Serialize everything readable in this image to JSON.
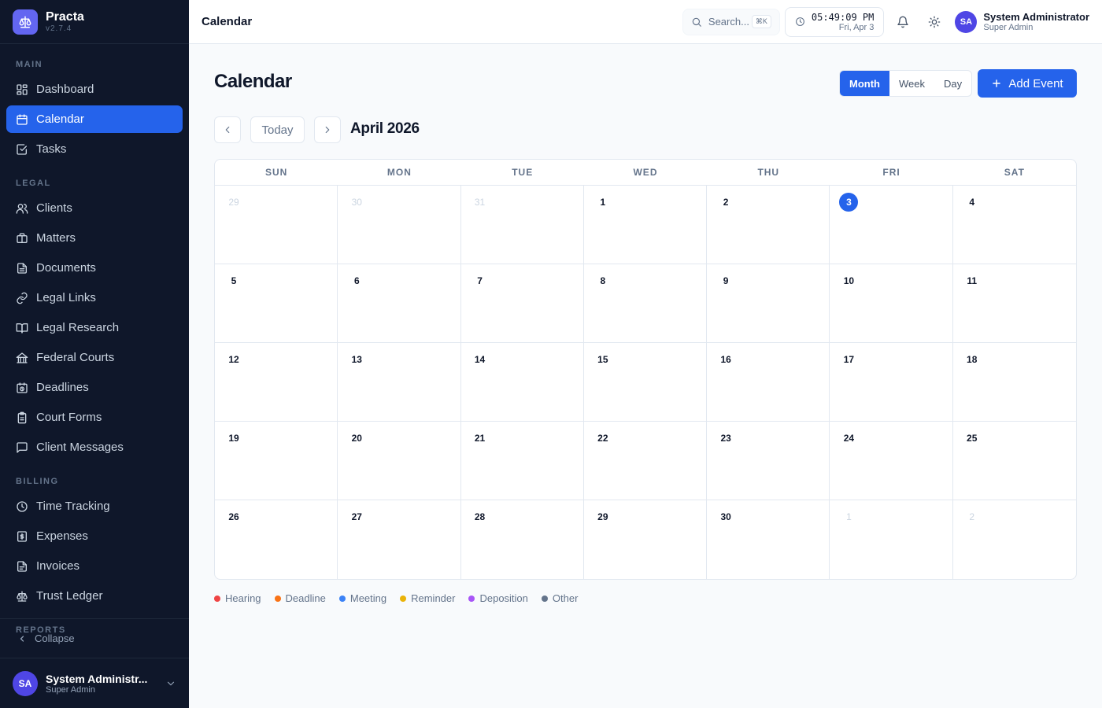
{
  "brand": {
    "name": "Practa",
    "version": "v2.7.4"
  },
  "sidebar": {
    "sections": [
      {
        "title": "MAIN",
        "items": [
          {
            "label": "Dashboard",
            "icon": "dashboard-icon"
          },
          {
            "label": "Calendar",
            "icon": "calendar-icon",
            "active": true
          },
          {
            "label": "Tasks",
            "icon": "tasks-icon"
          }
        ]
      },
      {
        "title": "LEGAL",
        "items": [
          {
            "label": "Clients",
            "icon": "users-icon"
          },
          {
            "label": "Matters",
            "icon": "briefcase-icon"
          },
          {
            "label": "Documents",
            "icon": "document-icon"
          },
          {
            "label": "Legal Links",
            "icon": "link-icon"
          },
          {
            "label": "Legal Research",
            "icon": "book-icon"
          },
          {
            "label": "Federal Courts",
            "icon": "courthouse-icon"
          },
          {
            "label": "Deadlines",
            "icon": "calendar-clock-icon"
          },
          {
            "label": "Court Forms",
            "icon": "clipboard-icon"
          },
          {
            "label": "Client Messages",
            "icon": "message-icon"
          }
        ]
      },
      {
        "title": "BILLING",
        "items": [
          {
            "label": "Time Tracking",
            "icon": "clock-icon"
          },
          {
            "label": "Expenses",
            "icon": "receipt-icon"
          },
          {
            "label": "Invoices",
            "icon": "invoice-icon"
          },
          {
            "label": "Trust Ledger",
            "icon": "scale-icon"
          }
        ]
      },
      {
        "title": "REPORTS",
        "items": []
      }
    ],
    "collapse_label": "Collapse",
    "user": {
      "initials": "SA",
      "name": "System Administr...",
      "role": "Super Admin"
    }
  },
  "header": {
    "title": "Calendar",
    "search_placeholder": "Search...",
    "search_shortcut": "⌘K",
    "clock_time": "05:49:09 PM",
    "clock_date": "Fri, Apr 3",
    "user": {
      "initials": "SA",
      "name": "System Administrator",
      "role": "Super Admin"
    }
  },
  "main": {
    "page_title": "Calendar",
    "views": [
      {
        "label": "Month",
        "active": true
      },
      {
        "label": "Week",
        "active": false
      },
      {
        "label": "Day",
        "active": false
      }
    ],
    "add_event_label": "Add Event",
    "today_label": "Today",
    "month_title": "April 2026",
    "weekdays": [
      "SUN",
      "MON",
      "TUE",
      "WED",
      "THU",
      "FRI",
      "SAT"
    ],
    "days": [
      {
        "n": "29",
        "muted": true
      },
      {
        "n": "30",
        "muted": true
      },
      {
        "n": "31",
        "muted": true
      },
      {
        "n": "1"
      },
      {
        "n": "2"
      },
      {
        "n": "3",
        "today": true
      },
      {
        "n": "4"
      },
      {
        "n": "5"
      },
      {
        "n": "6"
      },
      {
        "n": "7"
      },
      {
        "n": "8"
      },
      {
        "n": "9"
      },
      {
        "n": "10"
      },
      {
        "n": "11"
      },
      {
        "n": "12"
      },
      {
        "n": "13"
      },
      {
        "n": "14"
      },
      {
        "n": "15"
      },
      {
        "n": "16"
      },
      {
        "n": "17"
      },
      {
        "n": "18"
      },
      {
        "n": "19"
      },
      {
        "n": "20"
      },
      {
        "n": "21"
      },
      {
        "n": "22"
      },
      {
        "n": "23"
      },
      {
        "n": "24"
      },
      {
        "n": "25"
      },
      {
        "n": "26"
      },
      {
        "n": "27"
      },
      {
        "n": "28"
      },
      {
        "n": "29"
      },
      {
        "n": "30"
      },
      {
        "n": "1",
        "muted": true
      },
      {
        "n": "2",
        "muted": true
      }
    ],
    "legend": [
      {
        "label": "Hearing",
        "color": "#ef4444"
      },
      {
        "label": "Deadline",
        "color": "#f97316"
      },
      {
        "label": "Meeting",
        "color": "#3b82f6"
      },
      {
        "label": "Reminder",
        "color": "#eab308"
      },
      {
        "label": "Deposition",
        "color": "#a855f7"
      },
      {
        "label": "Other",
        "color": "#64748b"
      }
    ]
  },
  "colors": {
    "accent": "#2563eb",
    "sidebar_bg": "#0f172a",
    "avatar": "#4f46e5"
  }
}
